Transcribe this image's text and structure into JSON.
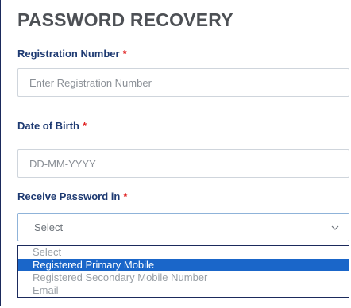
{
  "page": {
    "title": "PASSWORD RECOVERY"
  },
  "registration": {
    "label": "Registration Number",
    "required": "*",
    "placeholder": "Enter Registration Number"
  },
  "dob": {
    "label": "Date of Birth",
    "required": "*",
    "placeholder": "DD-MM-YYYY"
  },
  "receive": {
    "label": "Receive Password in",
    "required": "*",
    "selected": "Select",
    "options": [
      "Select",
      "Registered Primary Mobile",
      "Registered Secondary Mobile Number",
      "Email"
    ],
    "highlighted_option": "Registered Primary Mobile"
  },
  "colors": {
    "heading": "#4d5055",
    "label": "#1e3a72",
    "required": "#e02020",
    "highlight": "#1a66c9"
  }
}
